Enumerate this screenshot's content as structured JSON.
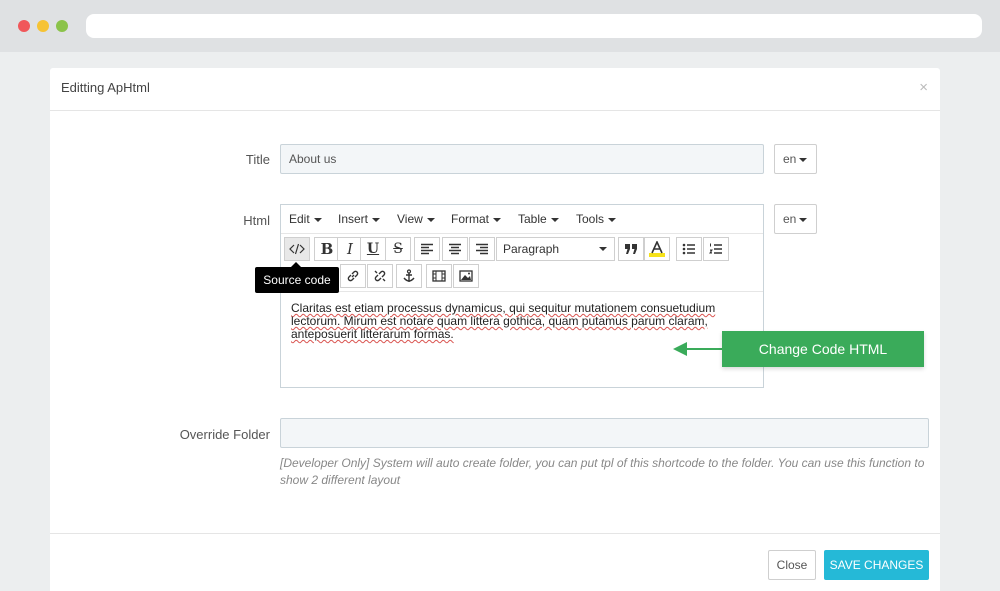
{
  "modal": {
    "title": "Editting ApHtml",
    "close_glyph": "×"
  },
  "form": {
    "title_label": "Title",
    "title_value": "About us",
    "title_lang": "en",
    "html_label": "Html",
    "html_lang": "en",
    "override_label": "Override Folder",
    "override_value": "",
    "help_text": "[Developer Only] System will auto create folder, you can put tpl of this shortcode to the folder. You can use this function to show 2 different layout"
  },
  "editor": {
    "menu": [
      "Edit",
      "Insert",
      "View",
      "Format",
      "Table",
      "Tools"
    ],
    "format_select": "Paragraph",
    "tooltip": "Source code",
    "toolbar_icons": [
      "source-code-icon",
      "bold-icon",
      "italic-icon",
      "underline-icon",
      "strikethrough-icon",
      "align-left-icon",
      "align-center-icon",
      "align-right-icon",
      "format-select",
      "blockquote-icon",
      "text-color-icon",
      "bullet-list-icon",
      "numbered-list-icon",
      "link-icon",
      "unlink-icon",
      "anchor-icon",
      "media-icon",
      "image-icon"
    ],
    "content_text": "Claritas est etiam processus dynamicus, qui sequitur mutationem consuetudium lectorum. Mirum est notare quam littera gothica, quam putamus parum claram, anteposuerit litterarum formas."
  },
  "callout": {
    "label": "Change Code HTML",
    "color": "#3aab5a"
  },
  "footer": {
    "close_label": "Close",
    "save_label": "SAVE CHANGES",
    "save_color": "#25b9d7"
  }
}
